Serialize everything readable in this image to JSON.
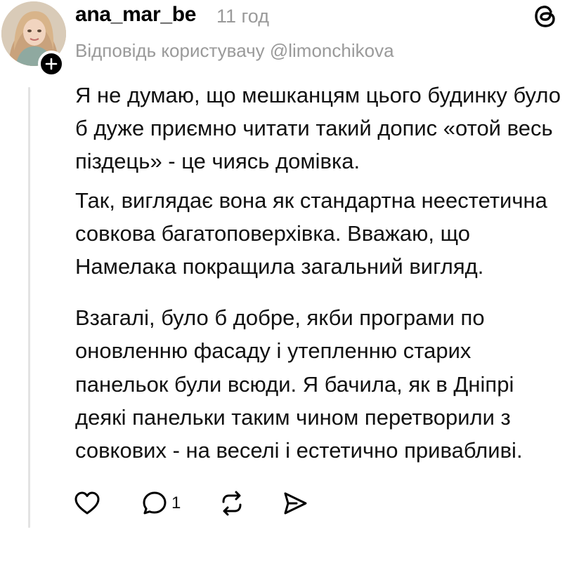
{
  "post": {
    "username": "ana_mar_be",
    "time": "11 год",
    "reply_to": "Відповідь користувачу @limonchikova",
    "paragraphs": [
      "Я не думаю, що мешканцям цього будинку було б дуже приємно читати такий допис «отой весь піздець» - це чиясь домівка.",
      "Так, виглядає вона як стандартна неестетична совкова багатоповерхівка. Вважаю, що Намелака покращила загальний вигляд.",
      "Взагалі, було б добре, якби програми по оновленню фасаду і утепленню старих панельок були всюди. Я бачила, як в Дніпрі деякі панельки таким чином перетворили з совкових - на веселі і естетично привабливі."
    ],
    "comments_count": "1"
  },
  "icons": {
    "avatar": "avatar-photo",
    "follow": "plus-icon",
    "logo": "threads-logo-icon",
    "like": "heart-icon",
    "comment": "comment-bubble-icon",
    "repost": "repost-icon",
    "share": "send-icon"
  }
}
